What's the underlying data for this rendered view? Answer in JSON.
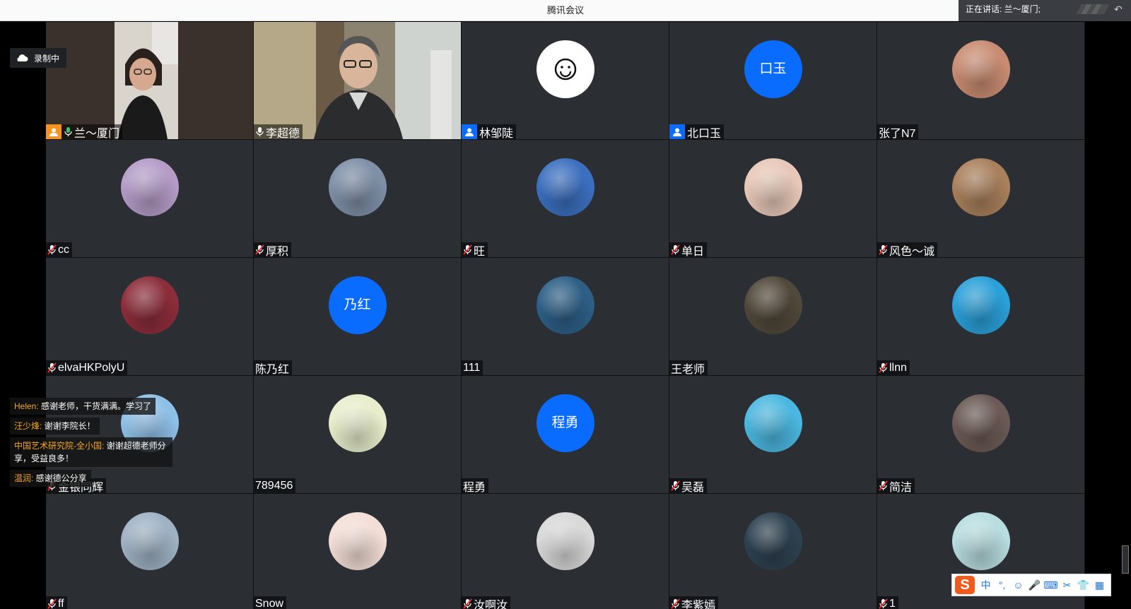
{
  "window": {
    "title": "腾讯会议",
    "speaking_label": "正在讲话: 兰～厦门;"
  },
  "recording": {
    "label": "录制中"
  },
  "participants": [
    {
      "name": "兰～厦门",
      "kind": "video1",
      "mic": "on",
      "badge": "host-orange",
      "active": true
    },
    {
      "name": "李超德",
      "kind": "video2",
      "mic": "on"
    },
    {
      "name": "林邹陡",
      "kind": "smile",
      "mic": "none",
      "badge": "user-blue"
    },
    {
      "name": "北口玉",
      "kind": "text",
      "avatar_text": "口玉",
      "mic": "none",
      "badge": "user-blue"
    },
    {
      "name": "张了N7",
      "kind": "photo",
      "color": "#c98c72",
      "mic": "none"
    },
    {
      "name": "cc",
      "kind": "photo",
      "color": "#b49cc7",
      "mic": "muted"
    },
    {
      "name": "厚积",
      "kind": "photo",
      "color": "#7e8fa6",
      "mic": "muted"
    },
    {
      "name": "旺",
      "kind": "photo",
      "color": "#3b6fbf",
      "mic": "muted"
    },
    {
      "name": "单日",
      "kind": "photo",
      "color": "#e7c8b8",
      "mic": "muted"
    },
    {
      "name": "风色～诚",
      "kind": "photo",
      "color": "#a9805c",
      "mic": "muted"
    },
    {
      "name": "elvaHKPolyU",
      "kind": "photo",
      "color": "#8b2d3a",
      "mic": "muted"
    },
    {
      "name": "陈乃红",
      "kind": "text",
      "avatar_text": "乃红",
      "mic": "none"
    },
    {
      "name": "111",
      "kind": "photo",
      "color": "#2d5f86",
      "mic": "none"
    },
    {
      "name": "王老师",
      "kind": "photo",
      "color": "#50483a",
      "mic": "none"
    },
    {
      "name": "llnn",
      "kind": "photo",
      "color": "#2aa0d8",
      "mic": "muted"
    },
    {
      "name": "金银同辉",
      "kind": "photo",
      "color": "#8fc0e8",
      "mic": "muted"
    },
    {
      "name": "789456",
      "kind": "photo",
      "color": "#e8edcc",
      "mic": "none"
    },
    {
      "name": "程勇",
      "kind": "text",
      "avatar_text": "程勇",
      "mic": "none"
    },
    {
      "name": "吴磊",
      "kind": "photo",
      "color": "#4bb7e0",
      "mic": "muted"
    },
    {
      "name": "简洁",
      "kind": "photo",
      "color": "#6b5a55",
      "mic": "muted"
    },
    {
      "name": "ff",
      "kind": "photo",
      "color": "#9fb2c4",
      "mic": "muted"
    },
    {
      "name": "Snow",
      "kind": "photo",
      "color": "#f3ded6",
      "mic": "none"
    },
    {
      "name": "汝啊汝",
      "kind": "photo",
      "color": "#d8d8d8",
      "mic": "muted"
    },
    {
      "name": "李紫嫣",
      "kind": "photo",
      "color": "#2e4150",
      "mic": "muted"
    },
    {
      "name": "1",
      "kind": "photo",
      "color": "#b8dde0",
      "mic": "muted"
    }
  ],
  "chat": [
    {
      "who": "Helen:",
      "text": "感谢老师，干货满满。学习了"
    },
    {
      "who": "汪少烽:",
      "text": "谢谢李院长！"
    },
    {
      "who": "中国艺术研究院-全小国:",
      "text": "谢谢超德老师分享，受益良多！"
    },
    {
      "who": "温润:",
      "text": "感谢德公分享"
    }
  ],
  "ime": {
    "logo": "S",
    "items": [
      "中",
      "°,",
      "☺",
      "🎤",
      "⌨",
      "✂",
      "👕",
      "▦"
    ]
  },
  "colors": {
    "tile_bg": "#2b2e33",
    "avatar_blue": "#0a6cff",
    "active_border": "#3ec46d",
    "chat_name": "#f5a623"
  }
}
